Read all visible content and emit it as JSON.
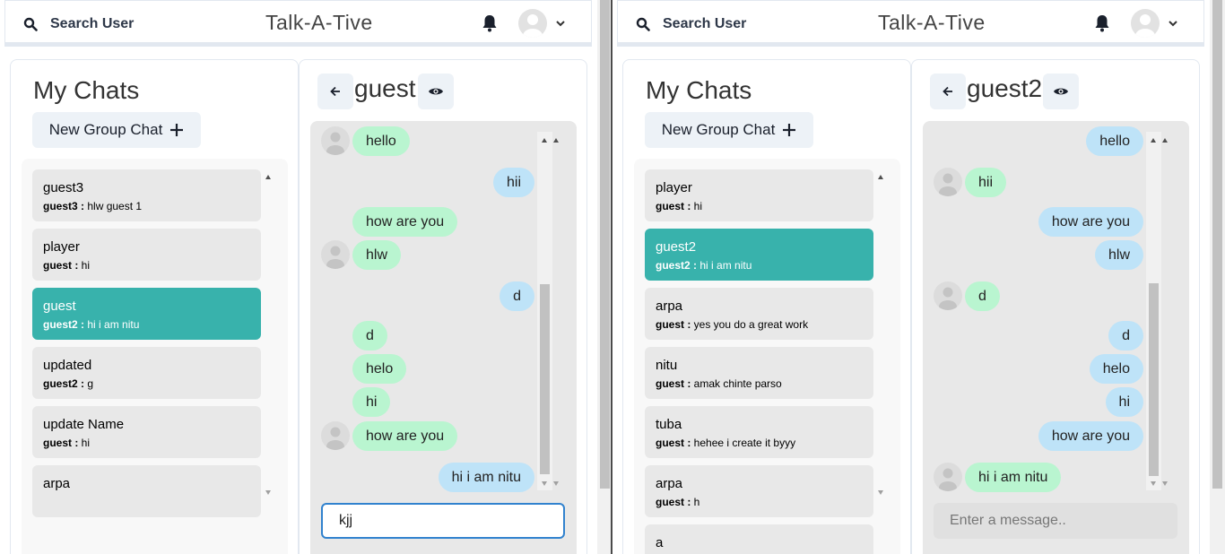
{
  "left": {
    "header": {
      "search_label": "Search User",
      "brand": "Talk-A-Tive"
    },
    "chats_title": "My Chats",
    "new_group_label": "New Group Chat",
    "chats": [
      {
        "name": "guest3",
        "sender": "guest3 :",
        "text": " hlw guest 1",
        "active": false
      },
      {
        "name": "player",
        "sender": "guest :",
        "text": " hi",
        "active": false
      },
      {
        "name": "guest",
        "sender": "guest2 :",
        "text": " hi i am nitu",
        "active": true
      },
      {
        "name": "updated",
        "sender": "guest2 :",
        "text": " g",
        "active": false
      },
      {
        "name": "update Name",
        "sender": "guest :",
        "text": " hi",
        "active": false
      },
      {
        "name": "arpa",
        "sender": "",
        "text": "",
        "active": false
      }
    ],
    "conversation": {
      "title": "guest",
      "messages": [
        {
          "text": "hello",
          "dir": "in",
          "avatar": true
        },
        {
          "text": "hii",
          "dir": "out",
          "avatar": false
        },
        {
          "text": "how are you",
          "dir": "in",
          "avatar": false
        },
        {
          "text": "hlw",
          "dir": "in",
          "avatar": true
        },
        {
          "text": "d",
          "dir": "out",
          "avatar": false
        },
        {
          "text": "d",
          "dir": "in",
          "avatar": false
        },
        {
          "text": "helo",
          "dir": "in",
          "avatar": false
        },
        {
          "text": "hi",
          "dir": "in",
          "avatar": false
        },
        {
          "text": "how are you",
          "dir": "in",
          "avatar": true
        },
        {
          "text": "hi i am nitu",
          "dir": "out",
          "avatar": false
        }
      ],
      "input_value": "kjj",
      "input_placeholder": "Enter a message.."
    }
  },
  "right": {
    "header": {
      "search_label": "Search User",
      "brand": "Talk-A-Tive"
    },
    "chats_title": "My Chats",
    "new_group_label": "New Group Chat",
    "chats": [
      {
        "name": "player",
        "sender": "guest :",
        "text": " hi",
        "active": false
      },
      {
        "name": "guest2",
        "sender": "guest2 :",
        "text": " hi i am nitu",
        "active": true
      },
      {
        "name": "arpa",
        "sender": "guest :",
        "text": " yes you do a great work",
        "active": false
      },
      {
        "name": "nitu",
        "sender": "guest :",
        "text": " amak chinte parso",
        "active": false
      },
      {
        "name": "tuba",
        "sender": "guest :",
        "text": " hehee i create it byyy",
        "active": false
      },
      {
        "name": "arpa",
        "sender": "guest :",
        "text": " h",
        "active": false
      },
      {
        "name": "a",
        "sender": "",
        "text": "",
        "active": false
      }
    ],
    "conversation": {
      "title": "guest2",
      "messages": [
        {
          "text": "hello",
          "dir": "out",
          "avatar": false
        },
        {
          "text": "hii",
          "dir": "in",
          "avatar": true
        },
        {
          "text": "how are you",
          "dir": "out",
          "avatar": false
        },
        {
          "text": "hlw",
          "dir": "out",
          "avatar": false
        },
        {
          "text": "d",
          "dir": "in",
          "avatar": true
        },
        {
          "text": "d",
          "dir": "out",
          "avatar": false
        },
        {
          "text": "helo",
          "dir": "out",
          "avatar": false
        },
        {
          "text": "hi",
          "dir": "out",
          "avatar": false
        },
        {
          "text": "how are you",
          "dir": "out",
          "avatar": false
        },
        {
          "text": "hi i am nitu",
          "dir": "in",
          "avatar": true
        }
      ],
      "input_value": "",
      "input_placeholder": "Enter a message.."
    }
  }
}
